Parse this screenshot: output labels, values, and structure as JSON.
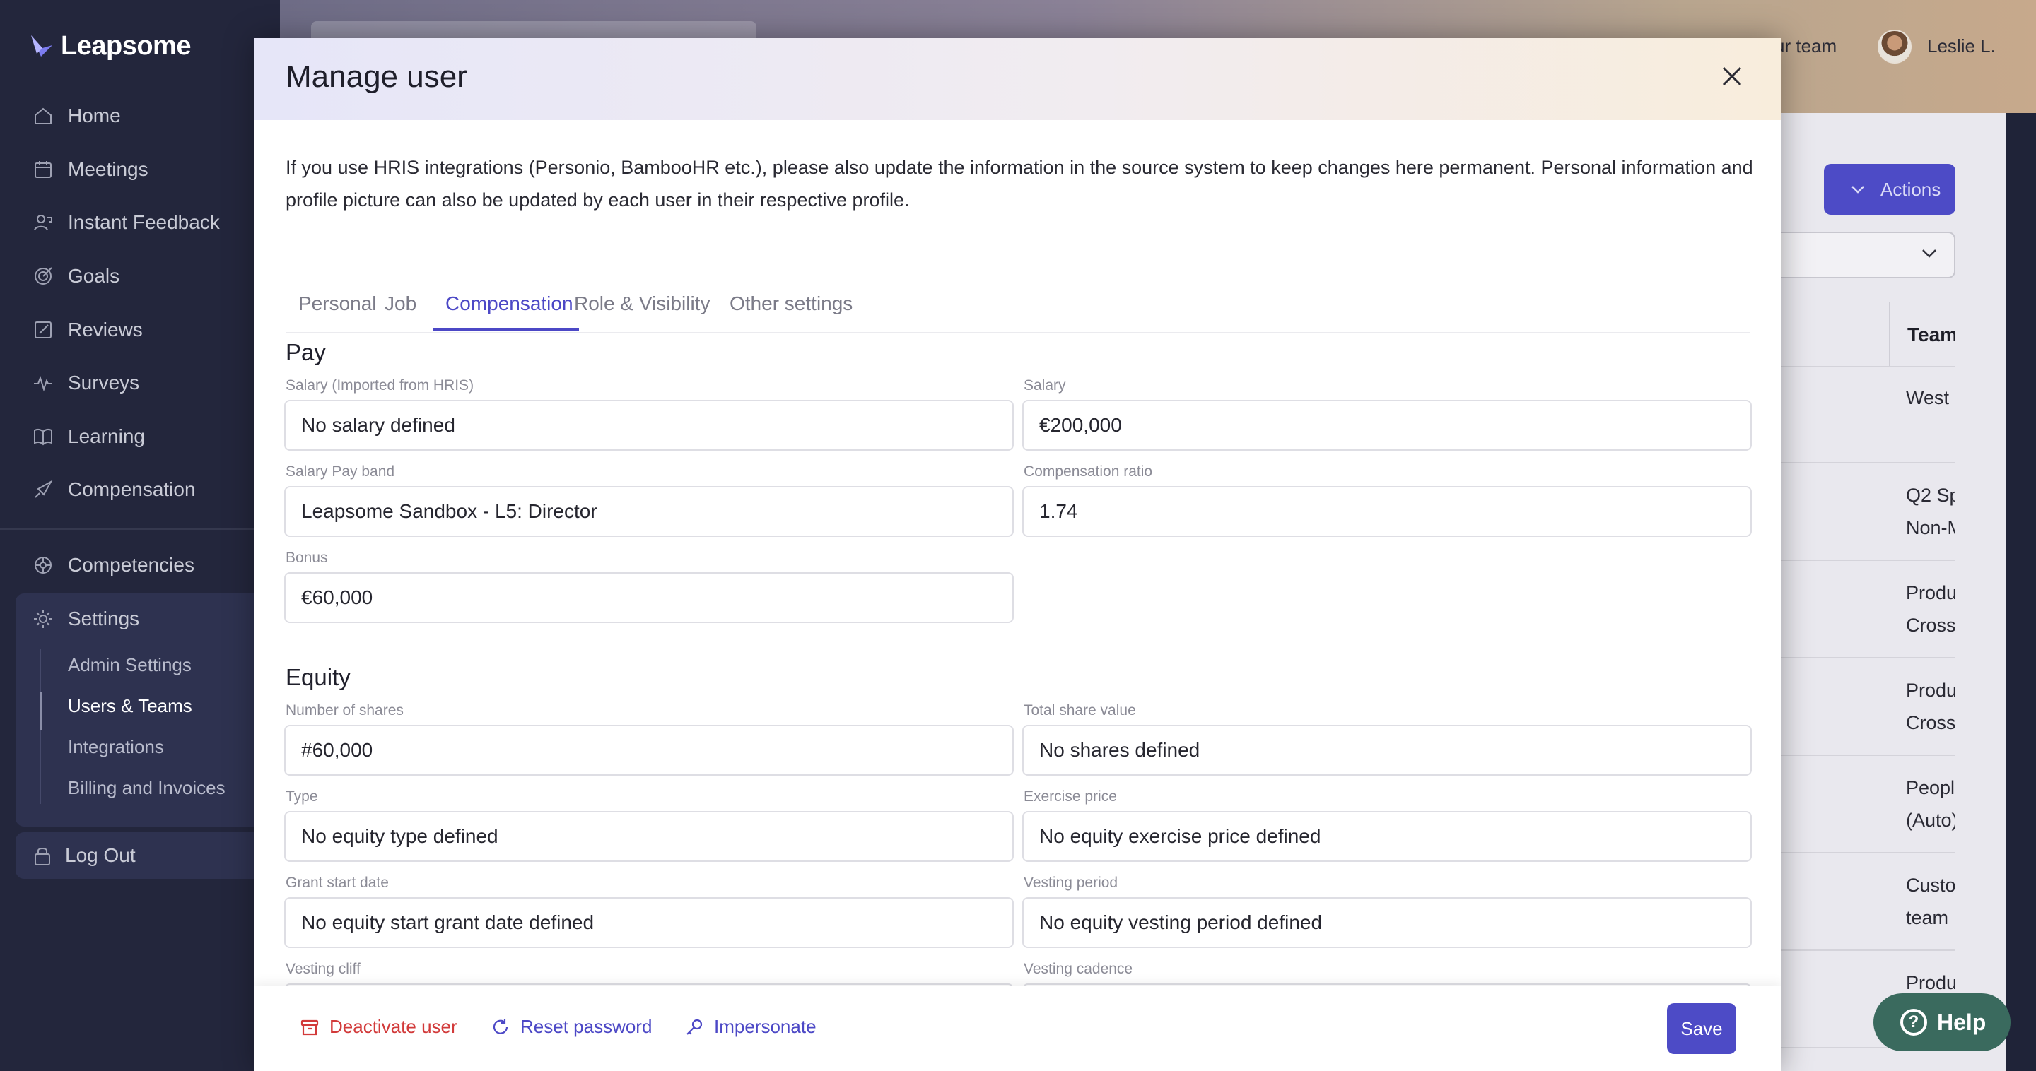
{
  "sidebar": {
    "brand": "Leapsome",
    "items": [
      {
        "label": "Home",
        "icon": "home-icon"
      },
      {
        "label": "Meetings",
        "icon": "meetings-icon"
      },
      {
        "label": "Instant Feedback",
        "icon": "feedback-icon"
      },
      {
        "label": "Goals",
        "icon": "goals-icon"
      },
      {
        "label": "Reviews",
        "icon": "reviews-icon"
      },
      {
        "label": "Surveys",
        "icon": "surveys-icon"
      },
      {
        "label": "Learning",
        "icon": "learning-icon"
      },
      {
        "label": "Compensation",
        "icon": "compensation-icon"
      },
      {
        "label": "Competencies",
        "icon": "competencies-icon"
      },
      {
        "label": "Settings",
        "icon": "gear-icon"
      }
    ],
    "settings_sub": [
      "Admin Settings",
      "Users & Teams",
      "Integrations",
      "Billing and Invoices"
    ],
    "logout": "Log Out"
  },
  "header": {
    "team_link": "ur team",
    "user_name": "Leslie L."
  },
  "background": {
    "actions_label": "Actions",
    "column_header": "Teams",
    "rows": [
      [
        "West "
      ],
      [
        "Q2 Sp",
        "Non-M"
      ],
      [
        "Produ",
        "Cross"
      ],
      [
        "Produ",
        "Cross"
      ],
      [
        "Peopl",
        "(Auto)"
      ],
      [
        "Custo",
        "team "
      ],
      [
        "Produ"
      ]
    ],
    "help_label": "Help"
  },
  "modal": {
    "title": "Manage user",
    "intro": "If you use HRIS integrations (Personio, BambooHR etc.), please also update the information in the source system to keep changes here permanent. Personal information and profile picture can also be updated by each user in their respective profile.",
    "tabs": [
      "Personal",
      "Job",
      "Compensation",
      "Role & Visibility",
      "Other settings"
    ],
    "active_tab": "Compensation",
    "pay": {
      "heading": "Pay",
      "salary_hris_label": "Salary (Imported from HRIS)",
      "salary_hris_value": "No salary defined",
      "salary_label": "Salary",
      "salary_value": "€200,000",
      "pay_band_label": "Salary Pay band",
      "pay_band_value": "Leapsome Sandbox - L5: Director",
      "comp_ratio_label": "Compensation ratio",
      "comp_ratio_value": "1.74",
      "bonus_label": "Bonus",
      "bonus_value": "€60,000"
    },
    "equity": {
      "heading": "Equity",
      "shares_label": "Number of shares",
      "shares_value": "#60,000",
      "share_value_label": "Total share value",
      "share_value_value": "No shares defined",
      "type_label": "Type",
      "type_value": "No equity type defined",
      "exercise_label": "Exercise price",
      "exercise_value": "No equity exercise price defined",
      "grant_label": "Grant start date",
      "grant_value": "No equity start grant date defined",
      "vesting_period_label": "Vesting period",
      "vesting_period_value": "No equity vesting period defined",
      "vesting_cliff_label": "Vesting cliff",
      "vesting_cadence_label": "Vesting cadence"
    },
    "footer": {
      "deactivate": "Deactivate user",
      "reset": "Reset password",
      "impersonate": "Impersonate",
      "save": "Save"
    }
  }
}
